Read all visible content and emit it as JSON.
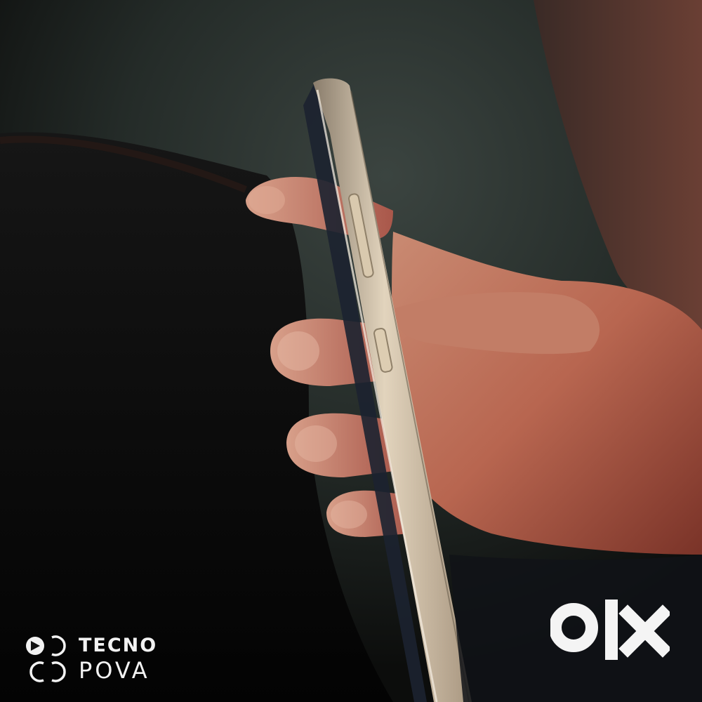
{
  "watermark": {
    "brand_line_1": "TECNO",
    "brand_line_2": "POVA",
    "icon": "tecno-camera-rings-icon"
  },
  "marketplace_logo": {
    "text": "OLX",
    "icon": "olx-logo-icon",
    "color": "#f4f4f4"
  },
  "colors": {
    "background": "#0b0b0b",
    "wall": "#2c3430",
    "skin": "#b76a52",
    "phone_frame": "#c9b9a0"
  }
}
